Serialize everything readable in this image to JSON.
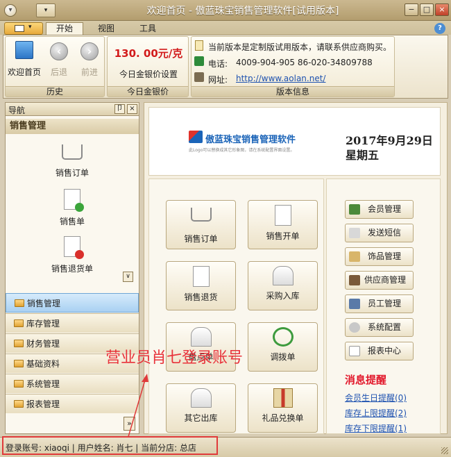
{
  "window": {
    "title": "欢迎首页 - 傲蓝珠宝销售管理软件[试用版本]",
    "minimize": "−",
    "maximize": "□",
    "close": "×"
  },
  "ribbon": {
    "tabs": [
      "开始",
      "视图",
      "工具"
    ],
    "active_tab": "开始",
    "groups": {
      "history": {
        "label": "历史",
        "home_label": "欢迎首页",
        "back_label": "后退",
        "forward_label": "前进"
      },
      "gold": {
        "label": "今日金银价",
        "price": "130. 00元/克",
        "setting_label": "今日金银价设置"
      },
      "version": {
        "label": "版本信息",
        "notice": "当前版本是定制版试用版本，请联系供应商购买。",
        "phone_label": "电话:",
        "phone": "4009-904-905  86-020-34809788",
        "site_label": "网址:",
        "site": "http://www.aolan.net/"
      }
    }
  },
  "nav": {
    "title": "导航",
    "pin": "卩",
    "close": "×",
    "section": "销售管理",
    "items": [
      {
        "label": "销售订单",
        "icon": "cart-icon"
      },
      {
        "label": "销售单",
        "icon": "document-add-icon"
      },
      {
        "label": "销售退货单",
        "icon": "document-remove-icon"
      }
    ],
    "groups": [
      "销售管理",
      "库存管理",
      "财务管理",
      "基础资料",
      "系统管理",
      "报表管理"
    ],
    "active_group": "销售管理",
    "expand": "»",
    "scroll_down": "∨"
  },
  "banner": {
    "logo_text": "傲蓝珠宝销售管理软件",
    "logo_sub": "此Logo可以替换成其它形象图，请在系统配置界面设置。",
    "date": "2017年9月29日",
    "weekday": "星期五"
  },
  "main_buttons": [
    {
      "label": "销售订单",
      "icon": "cart-icon"
    },
    {
      "label": "销售开单",
      "icon": "document-add-icon"
    },
    {
      "label": "销售退货",
      "icon": "document-remove-icon"
    },
    {
      "label": "采购入库",
      "icon": "house-icon"
    },
    {
      "label": "盘点单",
      "icon": "house-refresh-icon"
    },
    {
      "label": "调拨单",
      "icon": "transfer-icon"
    },
    {
      "label": "其它出库",
      "icon": "house-out-icon"
    },
    {
      "label": "礼品兑换单",
      "icon": "gift-icon"
    }
  ],
  "side_buttons": [
    {
      "label": "会员管理",
      "icon": "members-icon"
    },
    {
      "label": "发送短信",
      "icon": "message-icon"
    },
    {
      "label": "饰品管理",
      "icon": "box-icon"
    },
    {
      "label": "供应商管理",
      "icon": "supplier-icon"
    },
    {
      "label": "员工管理",
      "icon": "employee-icon"
    },
    {
      "label": "系统配置",
      "icon": "gear-icon"
    },
    {
      "label": "报表中心",
      "icon": "report-icon"
    }
  ],
  "messages": {
    "title": "消息提醒",
    "links": [
      "会员生日提醒(0)",
      "库存上限提醒(2)",
      "库存下限提醒(1)"
    ]
  },
  "annotation": "营业员肖七登录账号",
  "status_bar": "登录账号: xiaoqi  |  用户姓名: 肖七  |  当前分店: 总店",
  "colors": {
    "accent_red": "#e2182b",
    "price_red": "#d21b1b",
    "link_blue": "#1e52b0",
    "selected_blue": "#a9d0f2"
  }
}
